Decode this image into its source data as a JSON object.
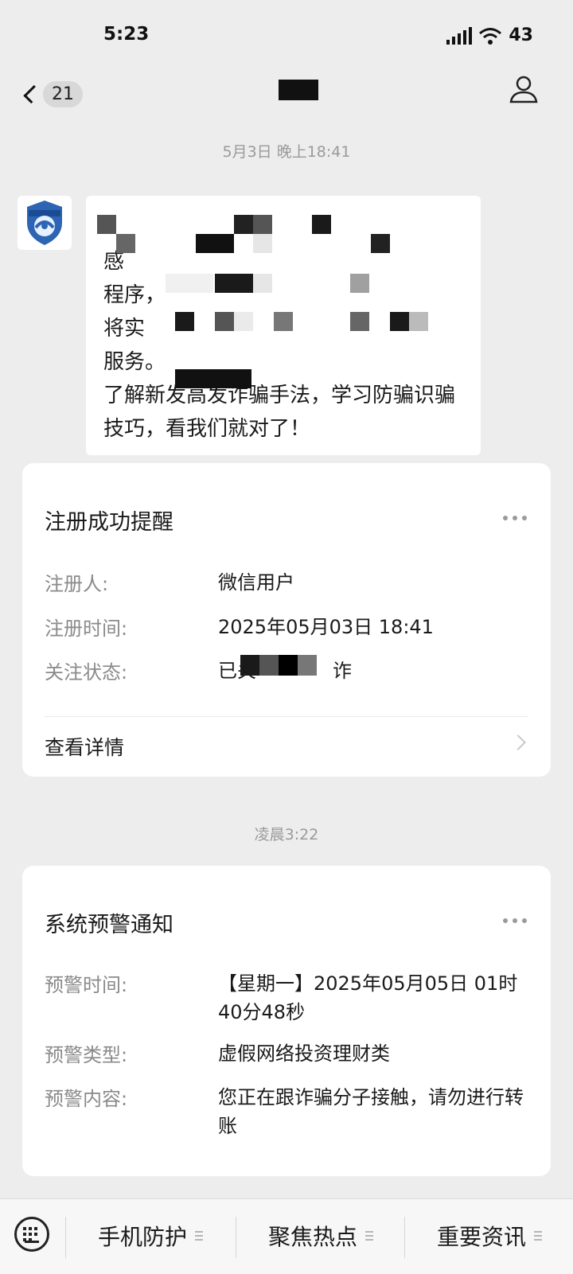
{
  "status_bar": {
    "time": "5:23",
    "battery": "43"
  },
  "nav": {
    "unread_count": "21",
    "back_icon": "chevron-left-icon",
    "profile_icon": "person-icon"
  },
  "chat": [
    {
      "type": "timestamp",
      "text": "5月3日 晚上18:41"
    },
    {
      "type": "message",
      "avatar_icon": "police-anti-fraud-shield-icon",
      "text": "感\n程序，\n将实\n服务。\n了解新发高发诈骗手法，学习防骗识骗技巧，看我们就对了！"
    },
    {
      "type": "card",
      "title": "注册成功提醒",
      "rows": [
        {
          "label": "注册人:",
          "value": "微信用户"
        },
        {
          "label": "注册时间:",
          "value": "2025年05月03日 18:41"
        },
        {
          "label": "关注状态:",
          "value": "已关　　　　诈"
        }
      ],
      "action": "查看详情"
    },
    {
      "type": "timestamp",
      "text": "凌晨3:22"
    },
    {
      "type": "card",
      "title": "系统预警通知",
      "rows": [
        {
          "label": "预警时间:",
          "value": "【星期一】2025年05月05日 01时40分48秒"
        },
        {
          "label": "预警类型:",
          "value": "虚假网络投资理财类"
        },
        {
          "label": "预警内容:",
          "value": "您正在跟诈骗分子接触，请勿进行转账"
        }
      ]
    }
  ],
  "bottom_menu": {
    "keyboard_icon": "keyboard-icon",
    "items": [
      "手机防护",
      "聚焦热点",
      "重要资讯"
    ]
  }
}
